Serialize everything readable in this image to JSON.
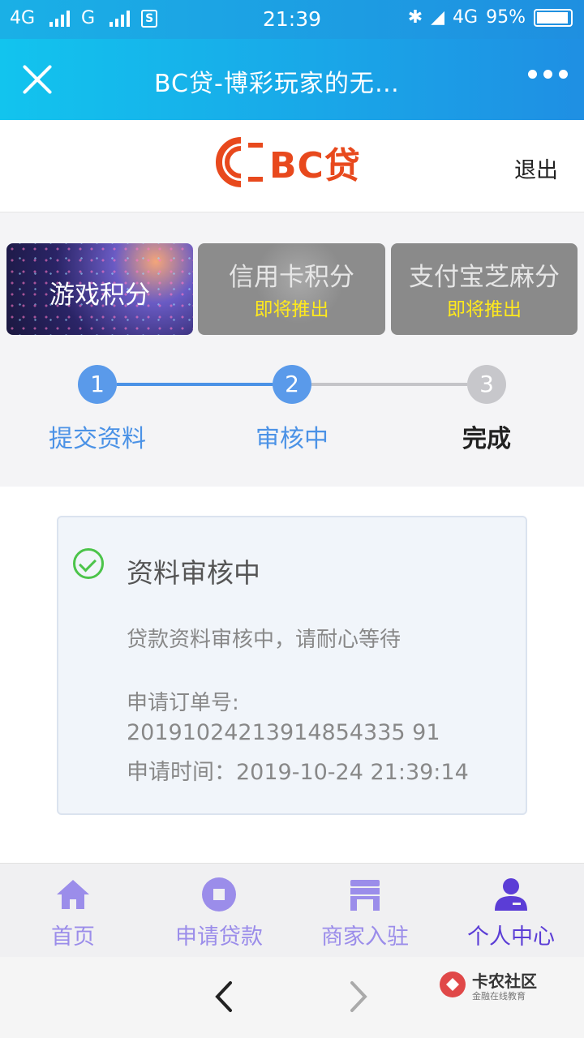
{
  "status_bar": {
    "net1": "4G",
    "net2": "G",
    "time": "21:39",
    "net3": "4G",
    "battery": "95%"
  },
  "title_bar": {
    "title": "BC贷-博彩玩家的无…"
  },
  "header": {
    "logo_text": "BC贷",
    "logout": "退出"
  },
  "cards": [
    {
      "label": "游戏积分"
    },
    {
      "label": "信用卡积分",
      "badge": "即将推出"
    },
    {
      "label": "支付宝芝麻分",
      "badge": "即将推出"
    }
  ],
  "steps": [
    {
      "num": "1",
      "label": "提交资料"
    },
    {
      "num": "2",
      "label": "审核中"
    },
    {
      "num": "3",
      "label": "完成"
    }
  ],
  "status": {
    "title": "资料审核中",
    "message": "贷款资料审核中，请耐心等待",
    "order_label": "申请订单号:",
    "order_no": "20191024213914854335 91",
    "apply_time": "申请时间：2019-10-24 21:39:14"
  },
  "tabs": [
    {
      "label": "首页"
    },
    {
      "label": "申请贷款"
    },
    {
      "label": "商家入驻"
    },
    {
      "label": "个人中心"
    }
  ],
  "watermark": {
    "title": "卡农社区",
    "subtitle": "金融在线教育"
  },
  "colors": {
    "accent_blue": "#4b92e6",
    "tab_purple": "#9b8dea",
    "tab_active": "#5b3dd6",
    "brand_orange": "#e8491d",
    "soon_yellow": "#ffe91d"
  }
}
